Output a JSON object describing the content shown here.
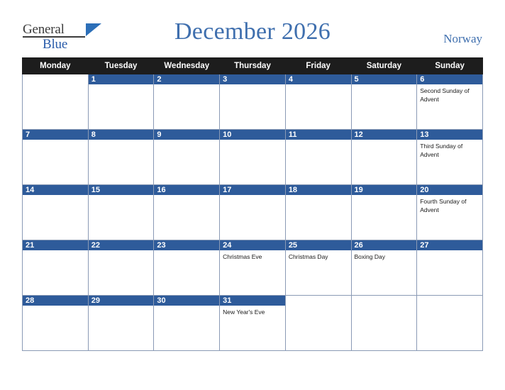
{
  "logo": {
    "word1": "General",
    "word2": "Blue"
  },
  "header": {
    "title": "December 2026",
    "country": "Norway"
  },
  "calendar": {
    "weekday_headers": [
      "Monday",
      "Tuesday",
      "Wednesday",
      "Thursday",
      "Friday",
      "Saturday",
      "Sunday"
    ],
    "weeks": [
      [
        {
          "day": "",
          "blank": true,
          "events": []
        },
        {
          "day": "1",
          "events": []
        },
        {
          "day": "2",
          "events": []
        },
        {
          "day": "3",
          "events": []
        },
        {
          "day": "4",
          "events": []
        },
        {
          "day": "5",
          "events": []
        },
        {
          "day": "6",
          "events": [
            "Second Sunday of Advent"
          ]
        }
      ],
      [
        {
          "day": "7",
          "events": []
        },
        {
          "day": "8",
          "events": []
        },
        {
          "day": "9",
          "events": []
        },
        {
          "day": "10",
          "events": []
        },
        {
          "day": "11",
          "events": []
        },
        {
          "day": "12",
          "events": []
        },
        {
          "day": "13",
          "events": [
            "Third Sunday of Advent"
          ]
        }
      ],
      [
        {
          "day": "14",
          "events": []
        },
        {
          "day": "15",
          "events": []
        },
        {
          "day": "16",
          "events": []
        },
        {
          "day": "17",
          "events": []
        },
        {
          "day": "18",
          "events": []
        },
        {
          "day": "19",
          "events": []
        },
        {
          "day": "20",
          "events": [
            "Fourth Sunday of Advent"
          ]
        }
      ],
      [
        {
          "day": "21",
          "events": []
        },
        {
          "day": "22",
          "events": []
        },
        {
          "day": "23",
          "events": []
        },
        {
          "day": "24",
          "events": [
            "Christmas Eve"
          ]
        },
        {
          "day": "25",
          "events": [
            "Christmas Day"
          ]
        },
        {
          "day": "26",
          "events": [
            "Boxing Day"
          ]
        },
        {
          "day": "27",
          "events": []
        }
      ],
      [
        {
          "day": "28",
          "events": []
        },
        {
          "day": "29",
          "events": []
        },
        {
          "day": "30",
          "events": []
        },
        {
          "day": "31",
          "events": [
            "New Year's Eve"
          ]
        },
        {
          "day": "",
          "blank": true,
          "events": []
        },
        {
          "day": "",
          "blank": true,
          "events": []
        },
        {
          "day": "",
          "blank": true,
          "events": []
        }
      ]
    ]
  },
  "colors": {
    "accent": "#2e5b9a",
    "title": "#3f6fae",
    "header_bg": "#1d1d1d",
    "grid": "#8a9ab5"
  }
}
